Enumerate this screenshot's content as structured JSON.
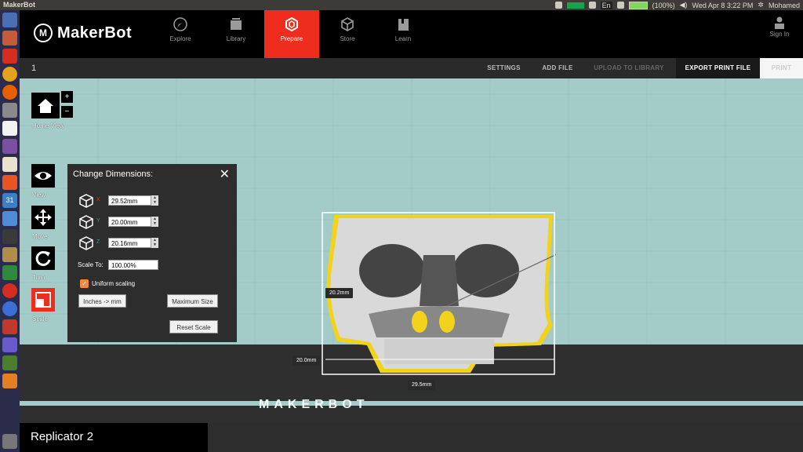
{
  "system_bar": {
    "window_title": "MakerBot",
    "keyboard_layout": "En",
    "battery": "(100%)",
    "clock": "Wed Apr  8  3:22 PM",
    "user": "Mohamed"
  },
  "header": {
    "brand": "MakerBot",
    "nav": [
      {
        "label": "Explore",
        "icon": "compass-icon"
      },
      {
        "label": "Library",
        "icon": "library-icon"
      },
      {
        "label": "Prepare",
        "icon": "prepare-cube-icon",
        "active": true
      },
      {
        "label": "Store",
        "icon": "store-cube-icon"
      },
      {
        "label": "Learn",
        "icon": "book-icon"
      }
    ],
    "sign_in": "Sign In"
  },
  "toolbar": {
    "project_number": "1",
    "settings": "SETTINGS",
    "add_file": "ADD FILE",
    "upload_to_library": "UPLOAD TO LIBRARY",
    "export_print_file": "EXPORT PRINT FILE",
    "print": "PRINT"
  },
  "tools": {
    "home_view": "Home View",
    "zoom_in": "+",
    "zoom_out": "−",
    "view": "View",
    "move": "Move",
    "turn": "Turn",
    "scale": "Scale"
  },
  "dimensions_panel": {
    "title": "Change Dimensions:",
    "close": "✕",
    "x_label": "X",
    "x_value": "29.52mm",
    "y_label": "Y",
    "y_value": "20.00mm",
    "z_label": "Z",
    "z_value": "20.16mm",
    "scale_to_label": "Scale To:",
    "scale_to_value": "100.00%",
    "uniform_scaling_label": "Uniform scaling",
    "uniform_scaling_checked": true,
    "inches_to_mm": "Inches -> mm",
    "maximum_size": "Maximum Size",
    "reset_scale": "Reset Scale"
  },
  "model": {
    "height_tag": "20.2mm",
    "depth_tag": "20.0mm",
    "width_tag": "29.5mm"
  },
  "build_plate_logo": "MAKERBOT",
  "printer": "Replicator 2",
  "colors": {
    "accent_red": "#ee2d1e",
    "viewport_bg": "#a3ccc9",
    "selection_yellow": "#f2d21b",
    "checkbox_orange": "#f0883e"
  }
}
